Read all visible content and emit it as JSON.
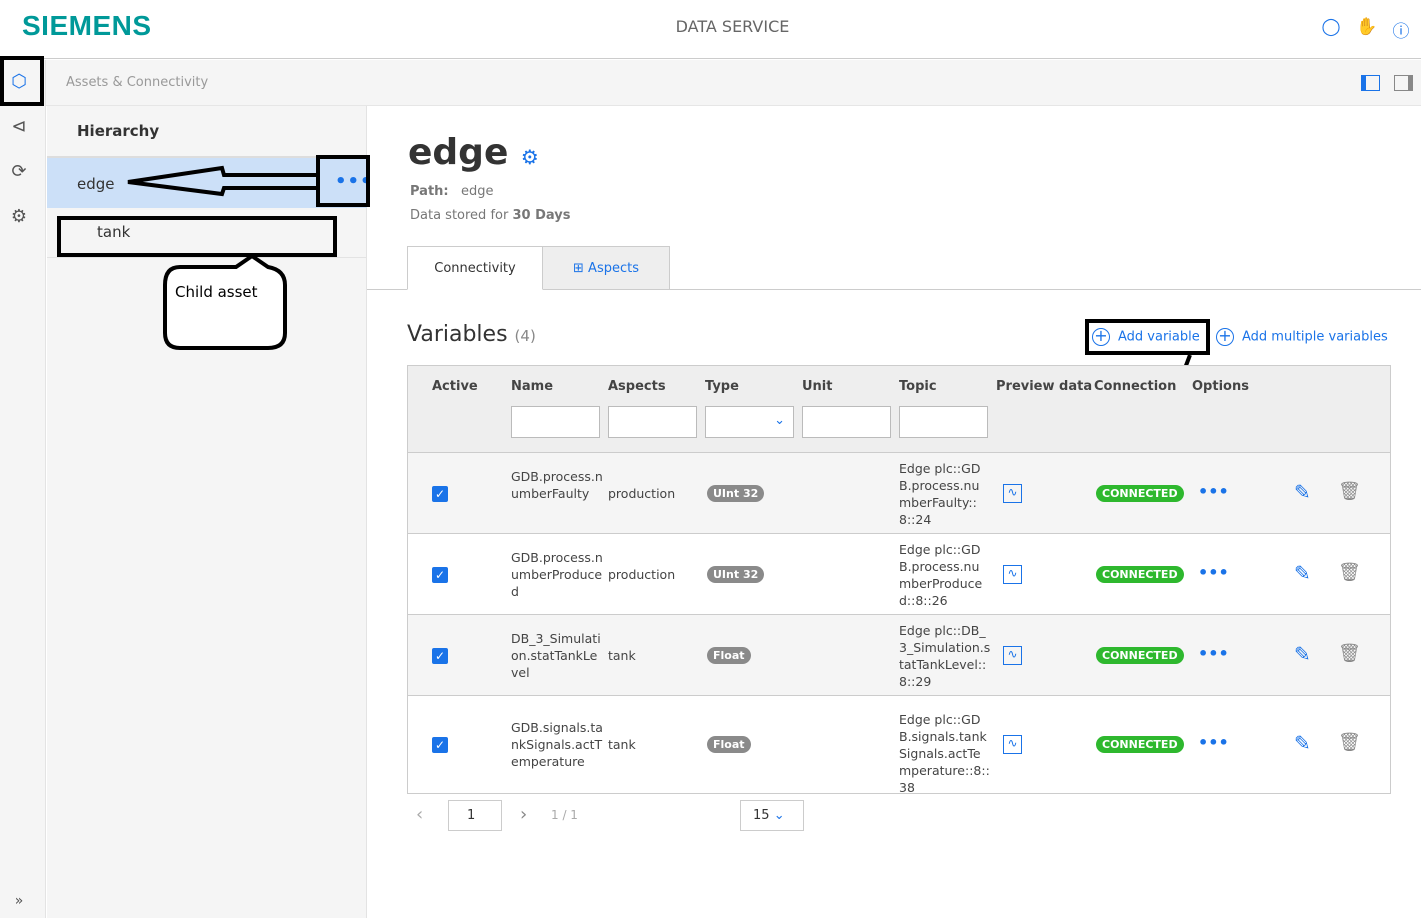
{
  "header": {
    "logo": "SIEMENS",
    "title": "DATA SERVICE",
    "icons": [
      "lightbulb-icon",
      "handshake-icon",
      "info-icon"
    ]
  },
  "rail": {
    "items": [
      "data-service-icon",
      "share-icon",
      "sync-icon",
      "settings-icon"
    ],
    "expand": "»"
  },
  "breadcrumb": {
    "label": "Assets & Connectivity"
  },
  "hierarchy": {
    "title": "Hierarchy",
    "items": [
      {
        "label": "edge",
        "selected": true
      },
      {
        "label": "tank"
      }
    ],
    "more": "•••"
  },
  "annotation": {
    "callout": "Child asset"
  },
  "asset": {
    "title": "edge",
    "path_label": "Path:",
    "path": "edge",
    "stored_prefix": "Data stored for",
    "stored_value": "30 Days"
  },
  "tabs": [
    {
      "label": "Connectivity",
      "active": true
    },
    {
      "label": "Aspects"
    }
  ],
  "variables": {
    "title": "Variables",
    "count": "(4)",
    "add": "Add variable",
    "add_multiple": "Add multiple variables",
    "columns": [
      "Active",
      "Name",
      "Aspects",
      "Type",
      "Unit",
      "Topic",
      "Preview data",
      "Connection",
      "Options"
    ],
    "rows": [
      {
        "name": "GDB.process.numberFaulty",
        "aspect": "production",
        "type": "UInt 32",
        "topic": "Edge plc::GDB.process.numberFaulty::8::24",
        "connection": "CONNECTED"
      },
      {
        "name": "GDB.process.numberProduced",
        "aspect": "production",
        "type": "UInt 32",
        "topic": "Edge plc::GDB.process.numberProduced::8::26",
        "connection": "CONNECTED"
      },
      {
        "name": "DB_3_Simulation.statTankLevel",
        "aspect": "tank",
        "type": "Float",
        "topic": "Edge plc::DB_3_Simulation.statTankLevel::8::29",
        "connection": "CONNECTED"
      },
      {
        "name": "GDB.signals.tankSignals.actTemperature",
        "aspect": "tank",
        "type": "Float",
        "topic": "Edge plc::GDB.signals.tankSignals.actTemperature::8::38",
        "connection": "CONNECTED"
      }
    ]
  },
  "pagination": {
    "page": "1",
    "of": "1 / 1",
    "page_size": "15"
  }
}
